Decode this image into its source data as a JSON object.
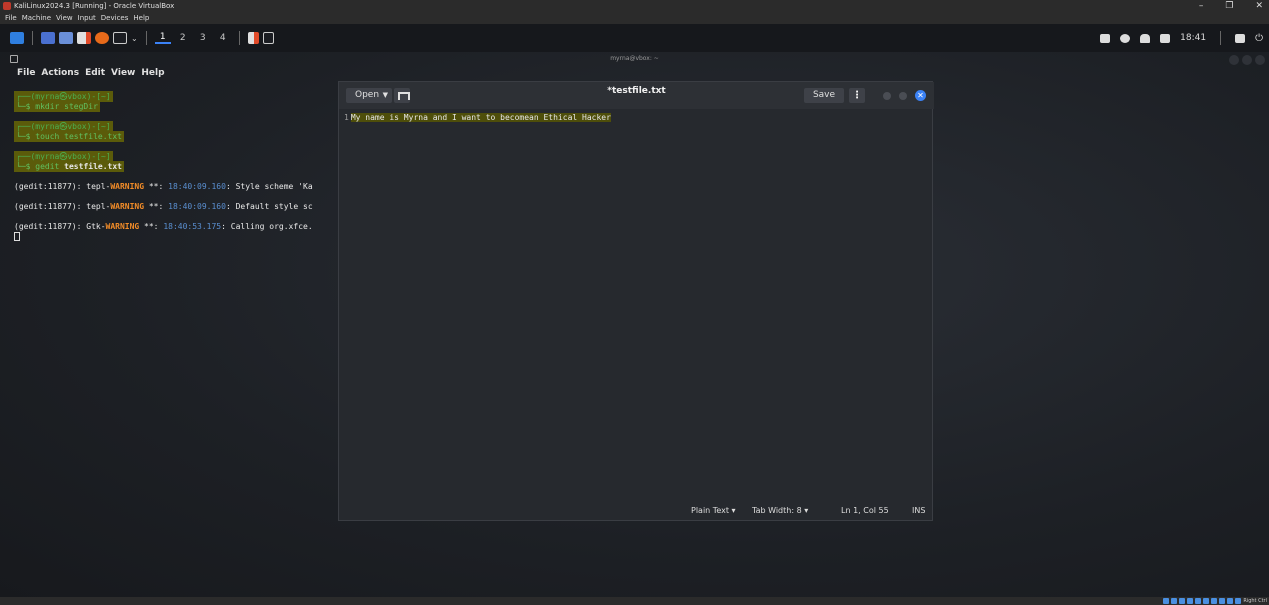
{
  "vbox": {
    "title": "KaliLinux2024.3 [Running] - Oracle VirtualBox",
    "menu": [
      "File",
      "Machine",
      "View",
      "Input",
      "Devices",
      "Help"
    ],
    "host_key": "Right Ctrl"
  },
  "panel": {
    "workspaces": [
      "1",
      "2",
      "3",
      "4"
    ],
    "clock": "18:41"
  },
  "terminal": {
    "window_title": "myrna@vbox: ~",
    "menu": [
      "File",
      "Actions",
      "Edit",
      "View",
      "Help"
    ],
    "prompts": [
      {
        "user": "┌──(myrna㉿vbox)-[~]",
        "cmd": "└─$ mkdir stegDir"
      },
      {
        "user": "┌──(myrna㉿vbox)-[~]",
        "cmd": "└─$ touch testfile.txt"
      },
      {
        "user": "┌──(myrna㉿vbox)-[~]",
        "cmd_prefix": "└─$ gedit ",
        "cmd_arg": "testfile.txt"
      }
    ],
    "warnings": [
      {
        "prefix": "(gedit:11877): tepl-",
        "level": "WARNING",
        "sep": " **: ",
        "time": "18:40:09.160",
        "msg": ": Style scheme 'Ka"
      },
      {
        "prefix": "(gedit:11877): tepl-",
        "level": "WARNING",
        "sep": " **: ",
        "time": "18:40:09.160",
        "msg": ": Default style sc"
      },
      {
        "prefix": "(gedit:11877): Gtk-",
        "level": "WARNING",
        "sep": " **: ",
        "time": "18:40:53.175",
        "msg": ": Calling org.xfce."
      }
    ]
  },
  "gedit": {
    "open_label": "Open",
    "title": "*testfile.txt",
    "save_label": "Save",
    "line_number": "1",
    "line_text": "My name is Myrna and I want to becomean Ethical Hacker",
    "status_language": "Plain Text ▾",
    "status_tab_width": "Tab Width: 8 ▾",
    "status_position": "Ln 1, Col 55",
    "status_mode": "INS"
  },
  "colors": {
    "accent": "#3b82f6",
    "warning": "#f28c28",
    "prompt_green": "#4caf50",
    "highlight": "#5b5b0a"
  }
}
